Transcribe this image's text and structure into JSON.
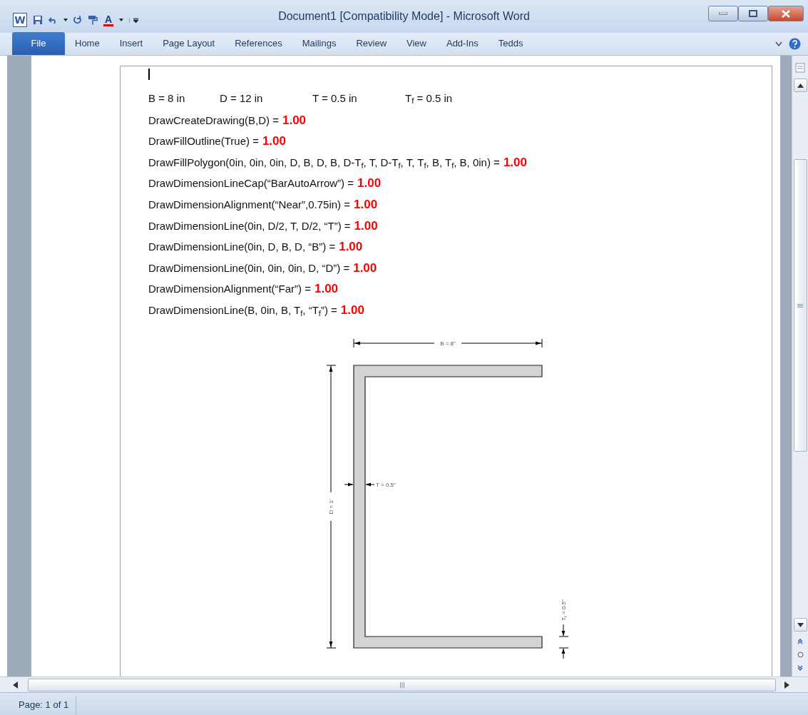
{
  "window": {
    "title": "Document1 [Compatibility Mode] - Microsoft Word",
    "app_icon": "W"
  },
  "quick_access_toolbar": {
    "font_color": "A"
  },
  "ribbon": {
    "tabs": [
      {
        "label": "File",
        "kind": "file",
        "selected": false
      },
      {
        "label": "Home",
        "kind": "tab",
        "selected": false
      },
      {
        "label": "Insert",
        "kind": "tab",
        "selected": false
      },
      {
        "label": "Page Layout",
        "kind": "tab",
        "selected": false
      },
      {
        "label": "References",
        "kind": "tab",
        "selected": false
      },
      {
        "label": "Mailings",
        "kind": "tab",
        "selected": false
      },
      {
        "label": "Review",
        "kind": "tab",
        "selected": false
      },
      {
        "label": "View",
        "kind": "tab",
        "selected": false
      },
      {
        "label": "Add-Ins",
        "kind": "tab",
        "selected": false
      },
      {
        "label": "Tedds",
        "kind": "tab",
        "selected": false
      }
    ]
  },
  "document": {
    "variables": [
      "B = 8 in",
      "D = 12 in",
      "T = 0.5 in",
      "T$_{f}$ = 0.5 in"
    ],
    "lines": [
      {
        "expression": "DrawCreateDrawing(B,D) =",
        "result": "1.00"
      },
      {
        "expression": "DrawFillOutline(True)  =",
        "result": "1.00"
      },
      {
        "expression": "DrawFillPolygon(0in,  0in, 0in, D, B, D, B, D-T$_{f}$, T, D-T$_{f}$, T, T$_{f}$, B, T$_{f}$, B, 0in) =",
        "result": "1.00"
      },
      {
        "expression": "DrawDimensionLineCap(“BarAutoArrow”)  =",
        "result": "1.00"
      },
      {
        "expression": "DrawDimensionAlignment(“Near”,0.75in)  =",
        "result": "1.00"
      },
      {
        "expression": "DrawDimensionLine(0in,  D/2, T, D/2, “T”) =",
        "result": "1.00"
      },
      {
        "expression": "DrawDimensionLine(0in,  D, B, D, “B”) =",
        "result": "1.00"
      },
      {
        "expression": "DrawDimensionLine(0in,  0in, 0in, D, “D”) =",
        "result": "1.00"
      },
      {
        "expression": "DrawDimensionAlignment(“Far”)  =",
        "result": "1.00"
      },
      {
        "expression": "DrawDimensionLine(B,  0in, B, T$_{f}$, “T$_{f}$”) =",
        "result": "1.00"
      }
    ],
    "drawing": {
      "width_label": "B = 8\"",
      "web_label": "T = 0.5\"",
      "depth_label": "D = 1'",
      "flange_label": "T$_{f}$ = 0.5\""
    }
  },
  "status_bar": {
    "page": "Page: 1 of 1"
  }
}
